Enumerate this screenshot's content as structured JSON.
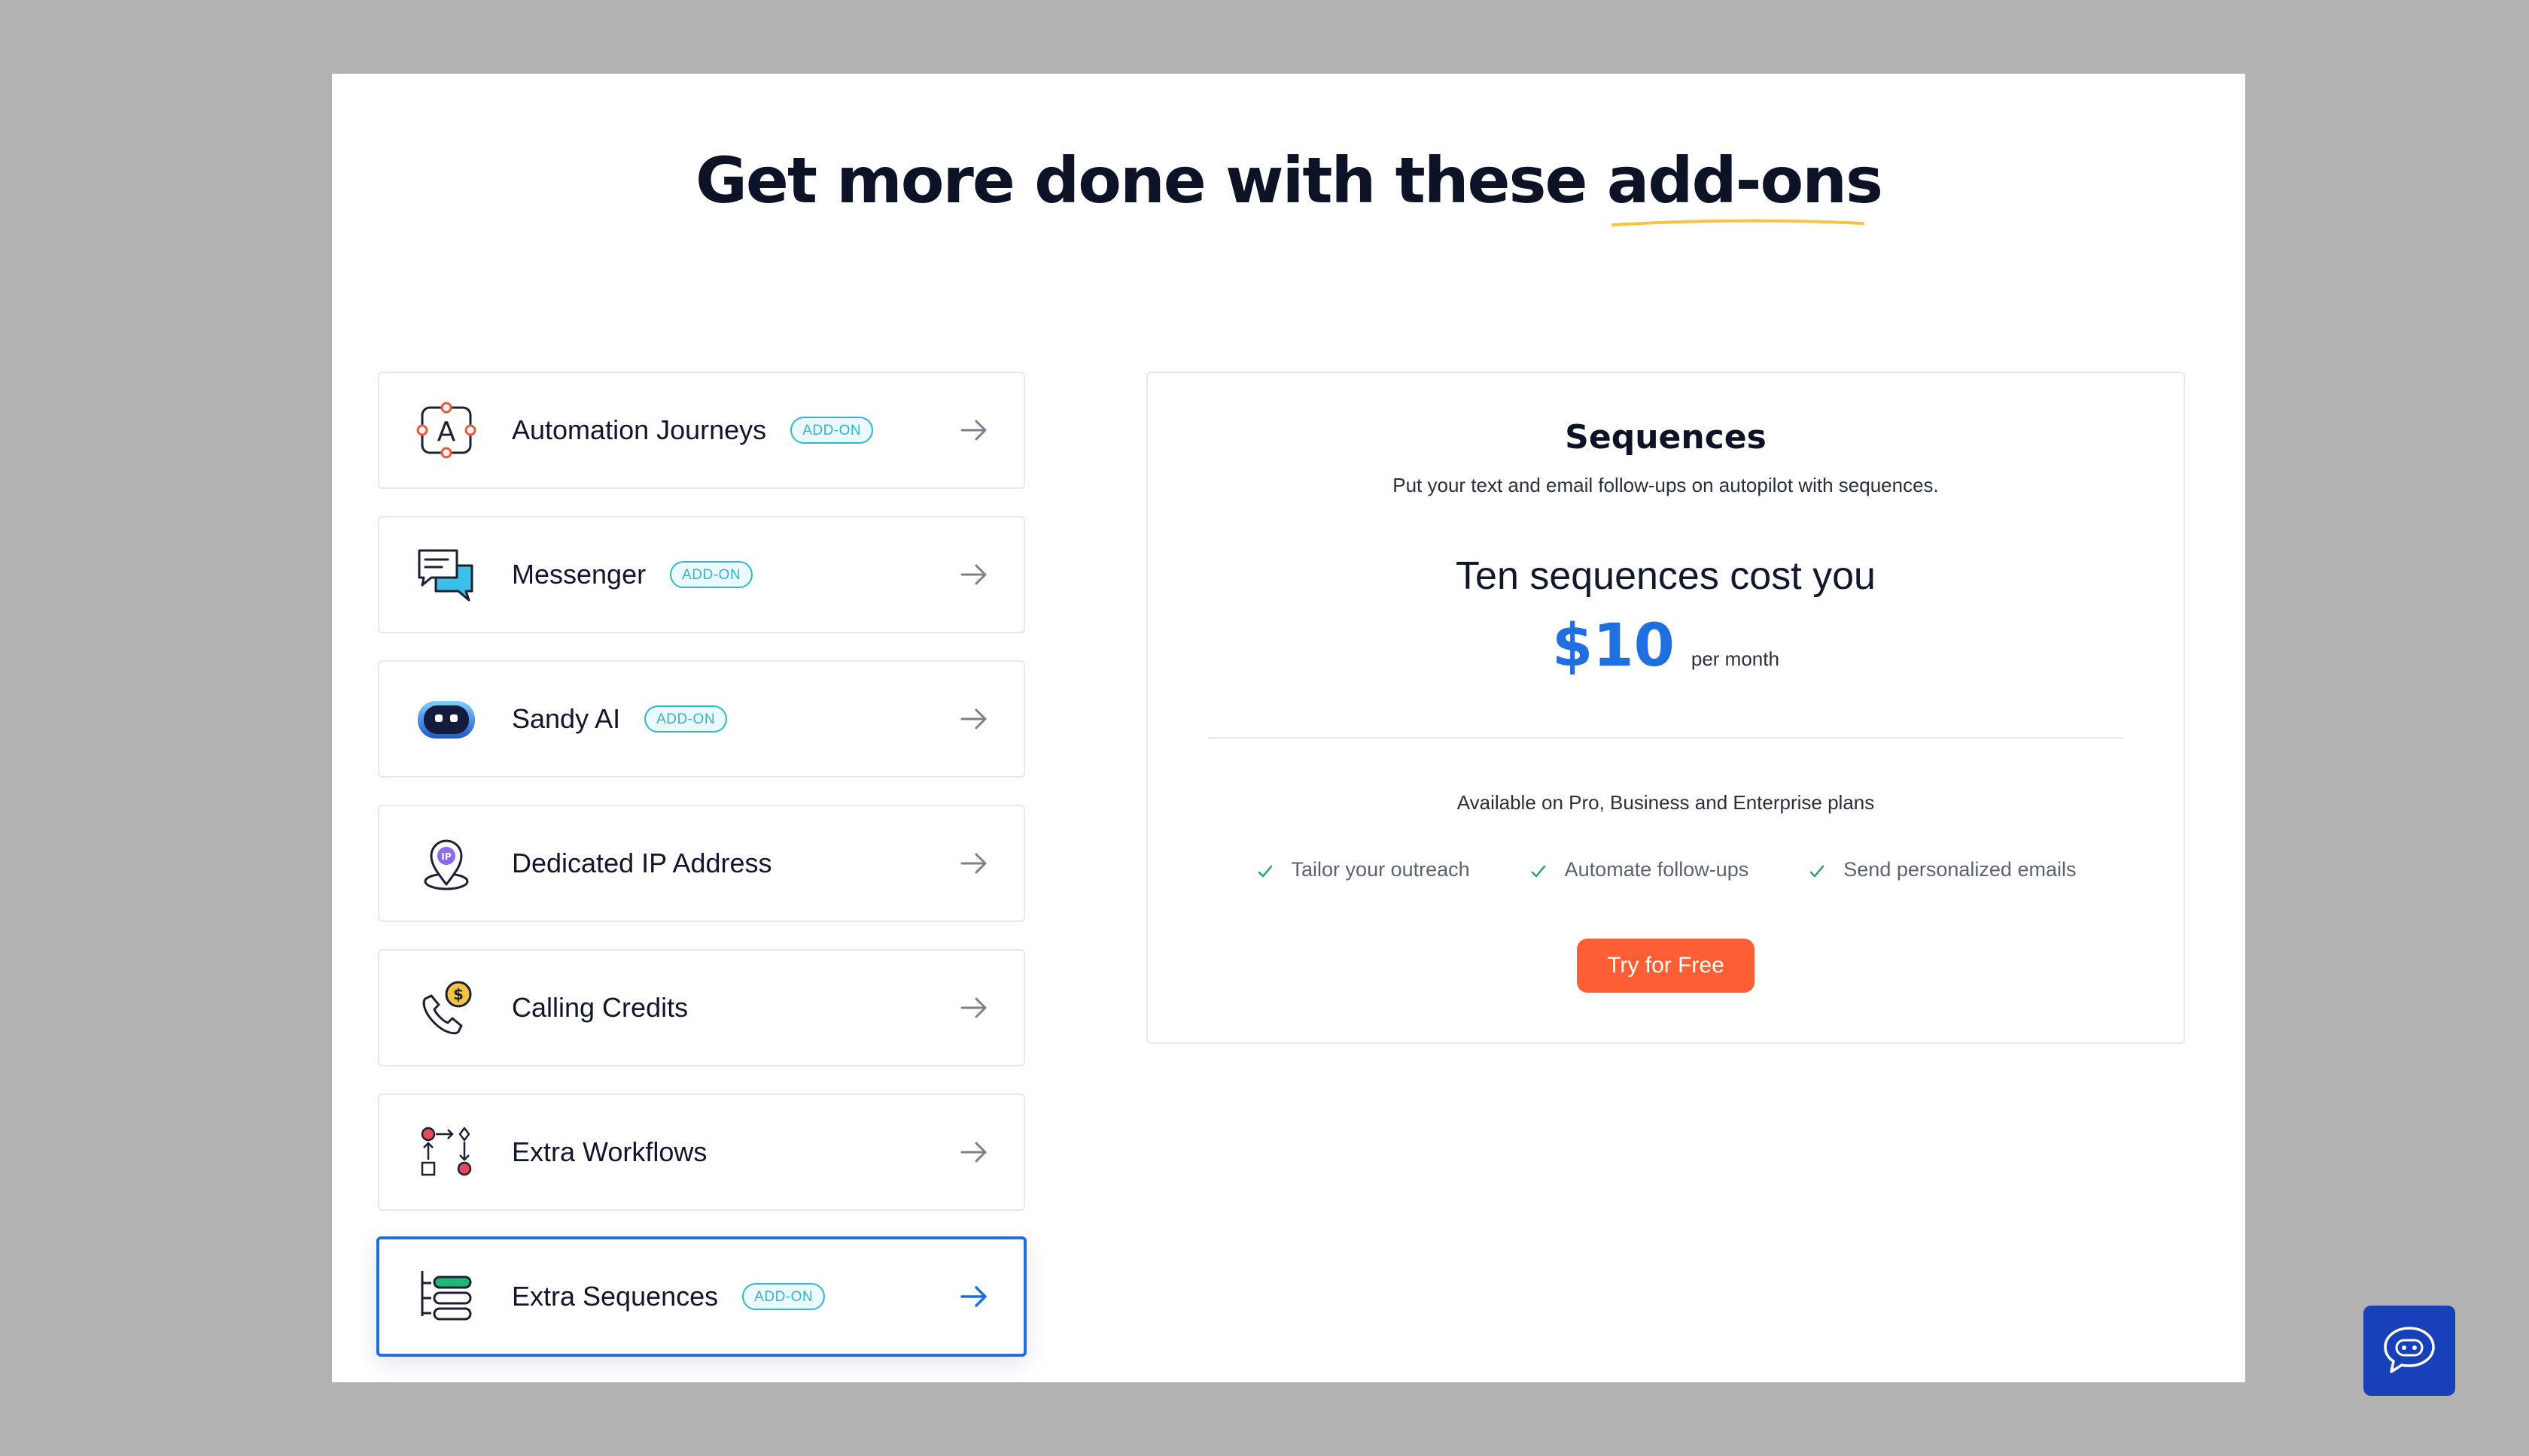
{
  "headline": {
    "text_main": "Get more done with these ",
    "text_highlight": "add-ons"
  },
  "addons": [
    {
      "label": "Automation Journeys",
      "badge": "ADD-ON",
      "icon": "automation-journey-icon",
      "active": false
    },
    {
      "label": "Messenger",
      "badge": "ADD-ON",
      "icon": "messenger-chat-icon",
      "active": false
    },
    {
      "label": "Sandy AI",
      "badge": "ADD-ON",
      "icon": "sandy-ai-robot-icon",
      "active": false
    },
    {
      "label": "Dedicated IP Address",
      "badge": "",
      "icon": "ip-location-pin-icon",
      "active": false
    },
    {
      "label": "Calling Credits",
      "badge": "",
      "icon": "phone-dollar-icon",
      "active": false
    },
    {
      "label": "Extra Workflows",
      "badge": "",
      "icon": "workflow-diagram-icon",
      "active": false
    },
    {
      "label": "Extra Sequences",
      "badge": "ADD-ON",
      "icon": "sequences-list-icon",
      "active": true
    }
  ],
  "panel": {
    "title": "Sequences",
    "subtitle": "Put your text and email follow-ups on autopilot with sequences.",
    "cost_line": "Ten sequences cost you",
    "price": "$10",
    "price_period": "per month",
    "availability": "Available on Pro, Business and Enterprise plans",
    "features": [
      "Tailor your outreach",
      "Automate follow-ups",
      "Send personalized emails"
    ],
    "cta_label": "Try for Free"
  },
  "colors": {
    "accent_blue": "#1f6fe0",
    "cta_orange": "#fd5e34",
    "badge_teal": "#2fb7d0",
    "check_green": "#25a36a",
    "highlight_underline": "#f6c344",
    "chat_widget_bg": "#1840b8"
  },
  "chat_widget": {
    "icon": "chat-support-icon"
  }
}
